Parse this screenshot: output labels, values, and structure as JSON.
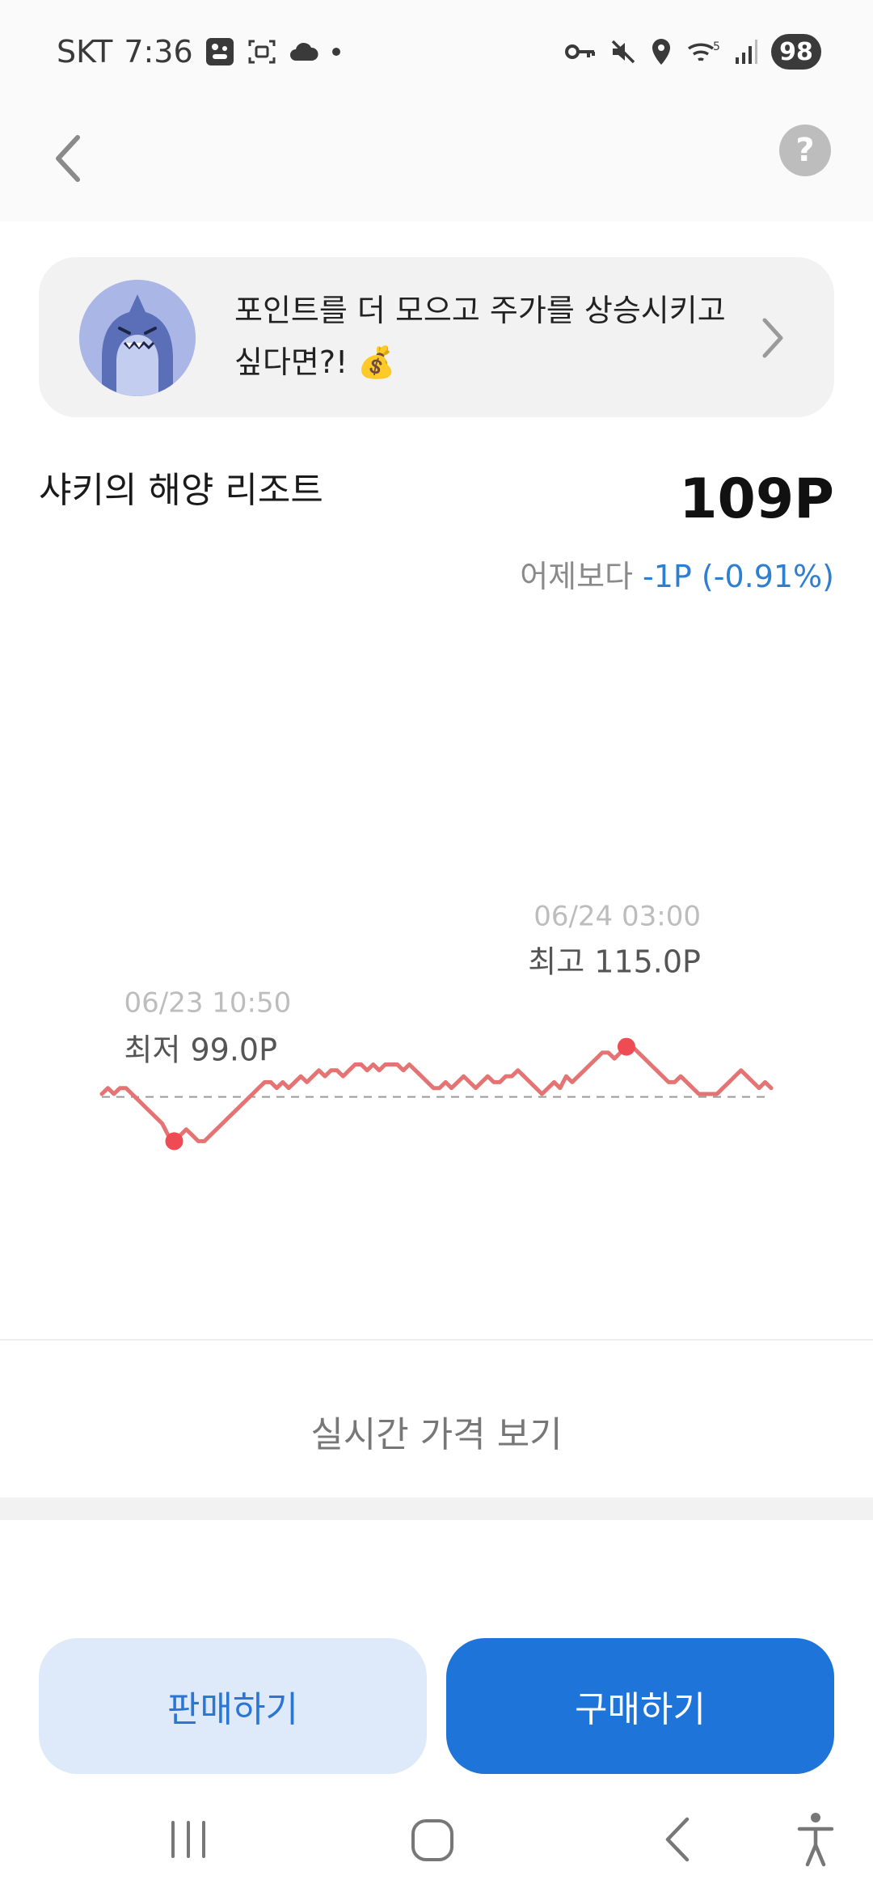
{
  "status_bar": {
    "carrier": "SKT",
    "time": "7:36",
    "battery": "98",
    "network_label": "5"
  },
  "nav": {
    "help_label": "?"
  },
  "promo": {
    "text": "포인트를 더 모으고 주가를 상승시키고 싶다면?! 💰"
  },
  "stock": {
    "name": "샤키의 해양 리조트",
    "price": "109P",
    "change_label": "어제보다",
    "change_value": "-1P (-0.91%)",
    "change_color": "#2f7fd1"
  },
  "chart_data": {
    "type": "line",
    "series": [
      {
        "values": [
          107,
          108,
          107,
          108,
          108,
          107,
          106,
          105,
          104,
          103,
          102,
          100,
          99,
          100,
          101,
          100,
          99,
          99,
          100,
          101,
          102,
          103,
          104,
          105,
          106,
          107,
          108,
          109,
          109,
          108,
          109,
          108,
          109,
          110,
          109,
          110,
          111,
          110,
          111,
          111,
          110,
          111,
          112,
          112,
          111,
          112,
          111,
          112,
          112,
          112,
          111,
          112,
          111,
          110,
          109,
          108,
          108,
          109,
          108,
          109,
          110,
          109,
          108,
          109,
          110,
          109,
          109,
          110,
          110,
          111,
          110,
          109,
          108,
          107,
          108,
          109,
          108,
          110,
          109,
          110,
          111,
          112,
          113,
          114,
          114,
          113,
          114,
          115,
          115,
          114,
          113,
          112,
          111,
          110,
          109,
          109,
          110,
          109,
          108,
          107,
          107,
          107,
          107,
          108,
          109,
          110,
          111,
          110,
          109,
          108,
          109,
          108
        ],
        "color": "#e57373"
      }
    ],
    "low": {
      "label": "최저 99.0P",
      "time": "06/23 10:50",
      "value": 99.0
    },
    "high": {
      "label": "최고 115.0P",
      "time": "06/24 03:00",
      "value": 115.0
    },
    "reference_line": 106.5,
    "ylim": [
      97,
      117
    ],
    "marker_color": "#ef4b55"
  },
  "realtime_link": "실시간 가격 보기",
  "actions": {
    "sell_label": "판매하기",
    "buy_label": "구매하기"
  },
  "icons": {
    "back": "chevron-left-icon",
    "help": "question-icon",
    "promo_avatar": "shark-character-icon",
    "promo_chevron": "chevron-right-icon"
  }
}
